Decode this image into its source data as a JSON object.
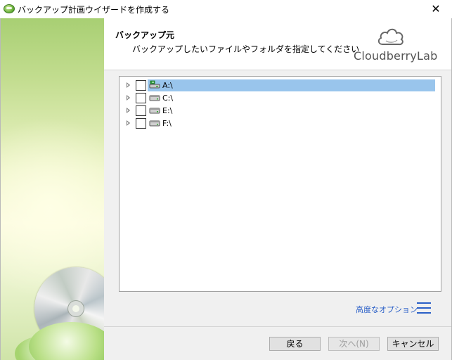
{
  "window": {
    "title": "バックアップ計画ウイザードを作成する",
    "close_glyph": "✕"
  },
  "header": {
    "title": "バックアップ元",
    "subtitle": "バックアップしたいファイルやフォルダを指定してください",
    "brand": "CloudberryLab"
  },
  "tree": {
    "items": [
      {
        "label": "A:\\",
        "icon": "network-drive-icon",
        "selected": true,
        "checked": false
      },
      {
        "label": "C:\\",
        "icon": "hard-drive-icon",
        "selected": false,
        "checked": false
      },
      {
        "label": "E:\\",
        "icon": "hard-drive-icon",
        "selected": false,
        "checked": false
      },
      {
        "label": "F:\\",
        "icon": "hard-drive-icon",
        "selected": false,
        "checked": false
      }
    ]
  },
  "options": {
    "advanced_label": "高度なオプション",
    "menu_icon": "hamburger-menu-icon"
  },
  "footer": {
    "back_label": "戻る",
    "next_label": "次へ(N)",
    "cancel_label": "キャンセル",
    "next_enabled": false
  },
  "colors": {
    "selection": "#99c5ec",
    "link": "#2a5fc7",
    "panel_green": "#a8cf73"
  }
}
